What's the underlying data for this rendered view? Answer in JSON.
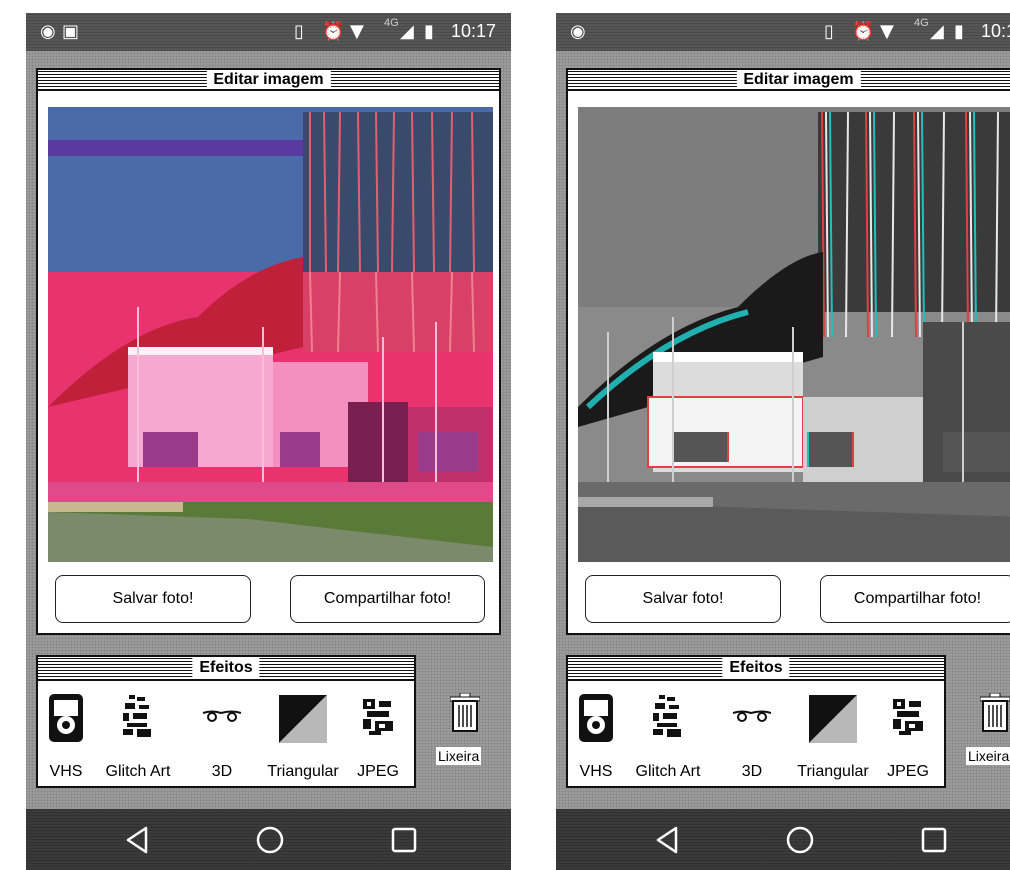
{
  "status_bar": {
    "time": "10:17",
    "network": "4G",
    "icons": [
      "eye-icon",
      "image-icon",
      "vibrate-icon",
      "alarm-icon",
      "wifi-icon",
      "signal-icon",
      "battery-icon"
    ]
  },
  "editor": {
    "title": "Editar imagem"
  },
  "buttons": {
    "save": "Salvar foto!",
    "share": "Compartilhar foto!"
  },
  "effects": {
    "title": "Efeitos",
    "items": [
      {
        "label": "VHS",
        "icon": "vhs-icon"
      },
      {
        "label": "Glitch Art",
        "icon": "glitch-icon"
      },
      {
        "label": "3D",
        "icon": "glasses-3d-icon"
      },
      {
        "label": "Triangular",
        "icon": "triangle-icon"
      },
      {
        "label": "JPEG",
        "icon": "jpeg-icon"
      }
    ]
  },
  "trash": {
    "label": "Lixeira"
  },
  "nav": [
    "back-icon",
    "home-icon",
    "recents-icon"
  ],
  "colors": {
    "glitch_pink": "#e8336e",
    "glitch_blue": "#4a6aa8",
    "nav_bg": "#3a3a3a",
    "page_bg": "#9c9c9c"
  }
}
